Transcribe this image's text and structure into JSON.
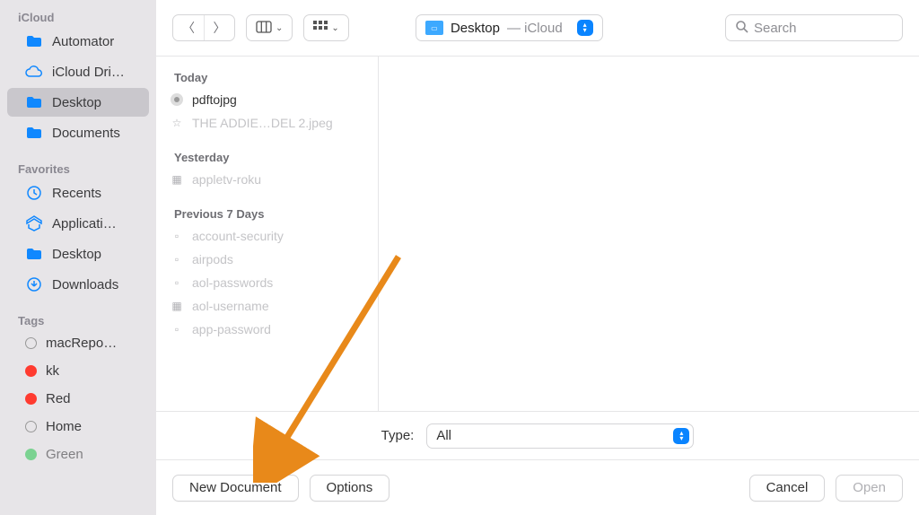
{
  "sidebar": {
    "sections": [
      {
        "title": "iCloud",
        "items": [
          {
            "label": "Automator",
            "icon": "folder"
          },
          {
            "label": "iCloud Dri…",
            "icon": "cloud"
          },
          {
            "label": "Desktop",
            "icon": "folder",
            "selected": true
          },
          {
            "label": "Documents",
            "icon": "folder"
          }
        ]
      },
      {
        "title": "Favorites",
        "items": [
          {
            "label": "Recents",
            "icon": "clock"
          },
          {
            "label": "Applicati…",
            "icon": "apps"
          },
          {
            "label": "Desktop",
            "icon": "folder"
          },
          {
            "label": "Downloads",
            "icon": "download"
          }
        ]
      },
      {
        "title": "Tags",
        "items": [
          {
            "label": "macRepo…",
            "icon": "tag-empty"
          },
          {
            "label": "kk",
            "icon": "tag-red"
          },
          {
            "label": "Red",
            "icon": "tag-red"
          },
          {
            "label": "Home",
            "icon": "tag-empty"
          },
          {
            "label": "Green",
            "icon": "tag-green"
          }
        ]
      }
    ]
  },
  "path": {
    "name": "Desktop",
    "suffix": " — iCloud"
  },
  "search_placeholder": "Search",
  "list": {
    "groups": [
      {
        "head": "Today",
        "files": [
          {
            "name": "pdftojpg",
            "icon": "automator",
            "available": true
          },
          {
            "name": "THE ADDIE…DEL 2.jpeg",
            "icon": "image",
            "available": false
          }
        ]
      },
      {
        "head": "Yesterday",
        "files": [
          {
            "name": "appletv-roku",
            "icon": "image",
            "available": false
          }
        ]
      },
      {
        "head": "Previous 7 Days",
        "files": [
          {
            "name": "account-security",
            "icon": "image",
            "available": false
          },
          {
            "name": "airpods",
            "icon": "image",
            "available": false
          },
          {
            "name": "aol-passwords",
            "icon": "image",
            "available": false
          },
          {
            "name": "aol-username",
            "icon": "image",
            "available": false
          },
          {
            "name": "app-password",
            "icon": "image",
            "available": false
          }
        ]
      }
    ]
  },
  "type": {
    "label": "Type:",
    "value": "All"
  },
  "buttons": {
    "new_document": "New Document",
    "options": "Options",
    "cancel": "Cancel",
    "open": "Open"
  }
}
